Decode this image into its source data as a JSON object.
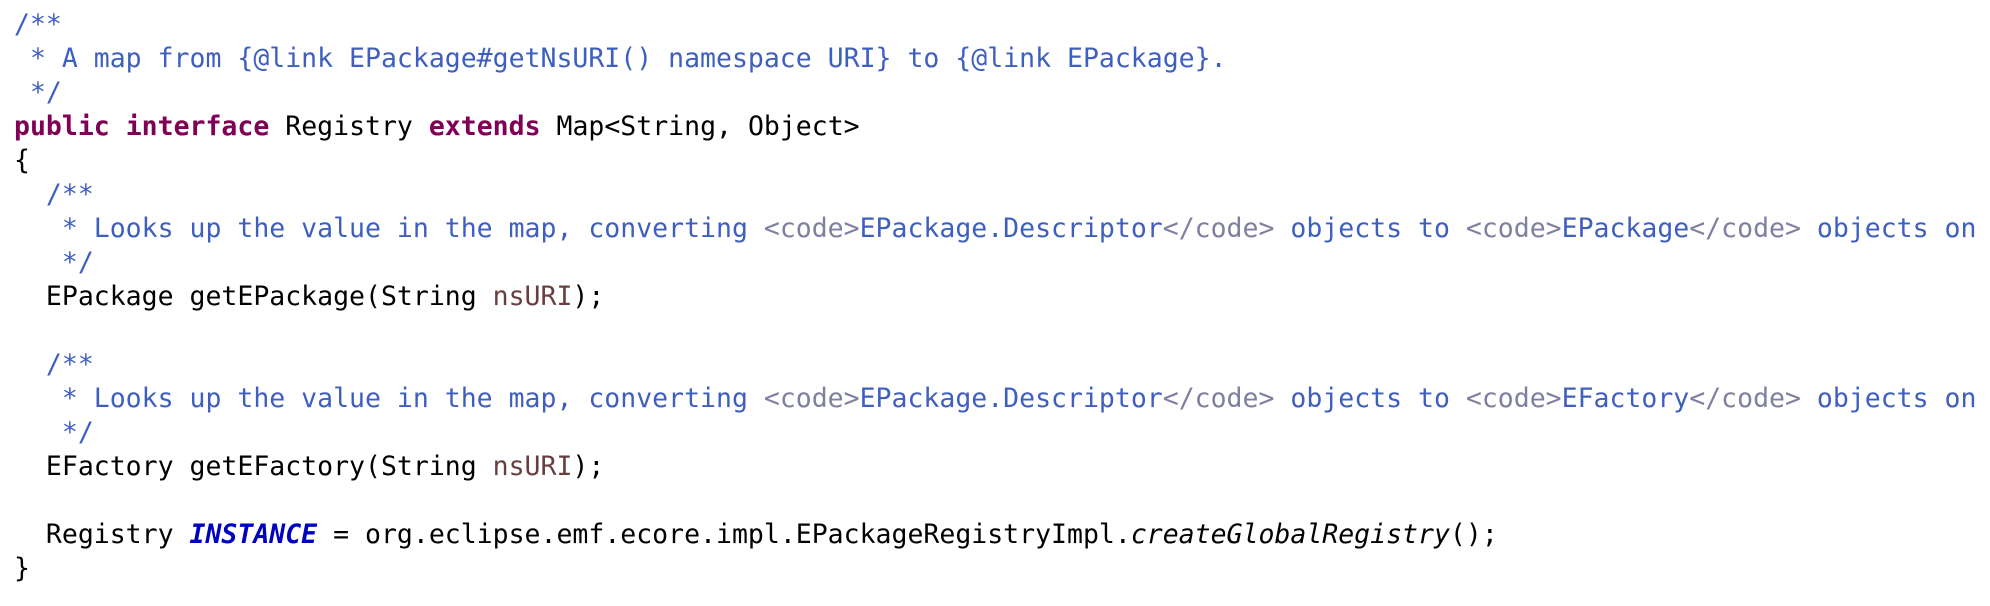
{
  "code": {
    "lines": [
      [
        {
          "t": "/**",
          "c": "doc"
        }
      ],
      [
        {
          "t": " * A map from {@link EPackage#getNsURI() namespace URI} to {@link EPackage}.",
          "c": "doc"
        }
      ],
      [
        {
          "t": " */",
          "c": "doc"
        }
      ],
      [
        {
          "t": "public",
          "c": "kw"
        },
        {
          "t": " ",
          "c": "plain"
        },
        {
          "t": "interface",
          "c": "kw"
        },
        {
          "t": " Registry ",
          "c": "plain"
        },
        {
          "t": "extends",
          "c": "kw"
        },
        {
          "t": " Map<String, Object>",
          "c": "plain"
        }
      ],
      [
        {
          "t": "{",
          "c": "plain"
        }
      ],
      [
        {
          "t": "  /**",
          "c": "doc"
        }
      ],
      [
        {
          "t": "   * Looks up the value in the map, converting ",
          "c": "doc"
        },
        {
          "t": "<code>",
          "c": "tag"
        },
        {
          "t": "EPackage.Descriptor",
          "c": "doc"
        },
        {
          "t": "</code>",
          "c": "tag"
        },
        {
          "t": " objects to ",
          "c": "doc"
        },
        {
          "t": "<code>",
          "c": "tag"
        },
        {
          "t": "EPackage",
          "c": "doc"
        },
        {
          "t": "</code>",
          "c": "tag"
        },
        {
          "t": " objects on demand.",
          "c": "doc"
        }
      ],
      [
        {
          "t": "   */",
          "c": "doc"
        }
      ],
      [
        {
          "t": "  EPackage getEPackage(String ",
          "c": "plain"
        },
        {
          "t": "nsURI",
          "c": "param"
        },
        {
          "t": ");",
          "c": "plain"
        }
      ],
      [
        {
          "t": "",
          "c": "plain"
        }
      ],
      [
        {
          "t": "  /**",
          "c": "doc"
        }
      ],
      [
        {
          "t": "   * Looks up the value in the map, converting ",
          "c": "doc"
        },
        {
          "t": "<code>",
          "c": "tag"
        },
        {
          "t": "EPackage.Descriptor",
          "c": "doc"
        },
        {
          "t": "</code>",
          "c": "tag"
        },
        {
          "t": " objects to ",
          "c": "doc"
        },
        {
          "t": "<code>",
          "c": "tag"
        },
        {
          "t": "EFactory",
          "c": "doc"
        },
        {
          "t": "</code>",
          "c": "tag"
        },
        {
          "t": " objects on demand.",
          "c": "doc"
        }
      ],
      [
        {
          "t": "   */",
          "c": "doc"
        }
      ],
      [
        {
          "t": "  EFactory getEFactory(String ",
          "c": "plain"
        },
        {
          "t": "nsURI",
          "c": "param"
        },
        {
          "t": ");",
          "c": "plain"
        }
      ],
      [
        {
          "t": "",
          "c": "plain"
        }
      ],
      [
        {
          "t": "  Registry ",
          "c": "plain"
        },
        {
          "t": "INSTANCE",
          "c": "static-field"
        },
        {
          "t": " = org.eclipse.emf.ecore.impl.EPackageRegistryImpl.",
          "c": "plain"
        },
        {
          "t": "createGlobalRegistry",
          "c": "static-method"
        },
        {
          "t": "();",
          "c": "plain"
        }
      ],
      [
        {
          "t": "}",
          "c": "plain"
        }
      ]
    ]
  },
  "colors": {
    "javadoc": "#3f5fbf",
    "html_tag": "#7f7f9f",
    "keyword": "#7f0055",
    "parameter": "#6a3e3e",
    "static_field": "#0000c0",
    "text": "#000000",
    "background": "#ffffff"
  }
}
